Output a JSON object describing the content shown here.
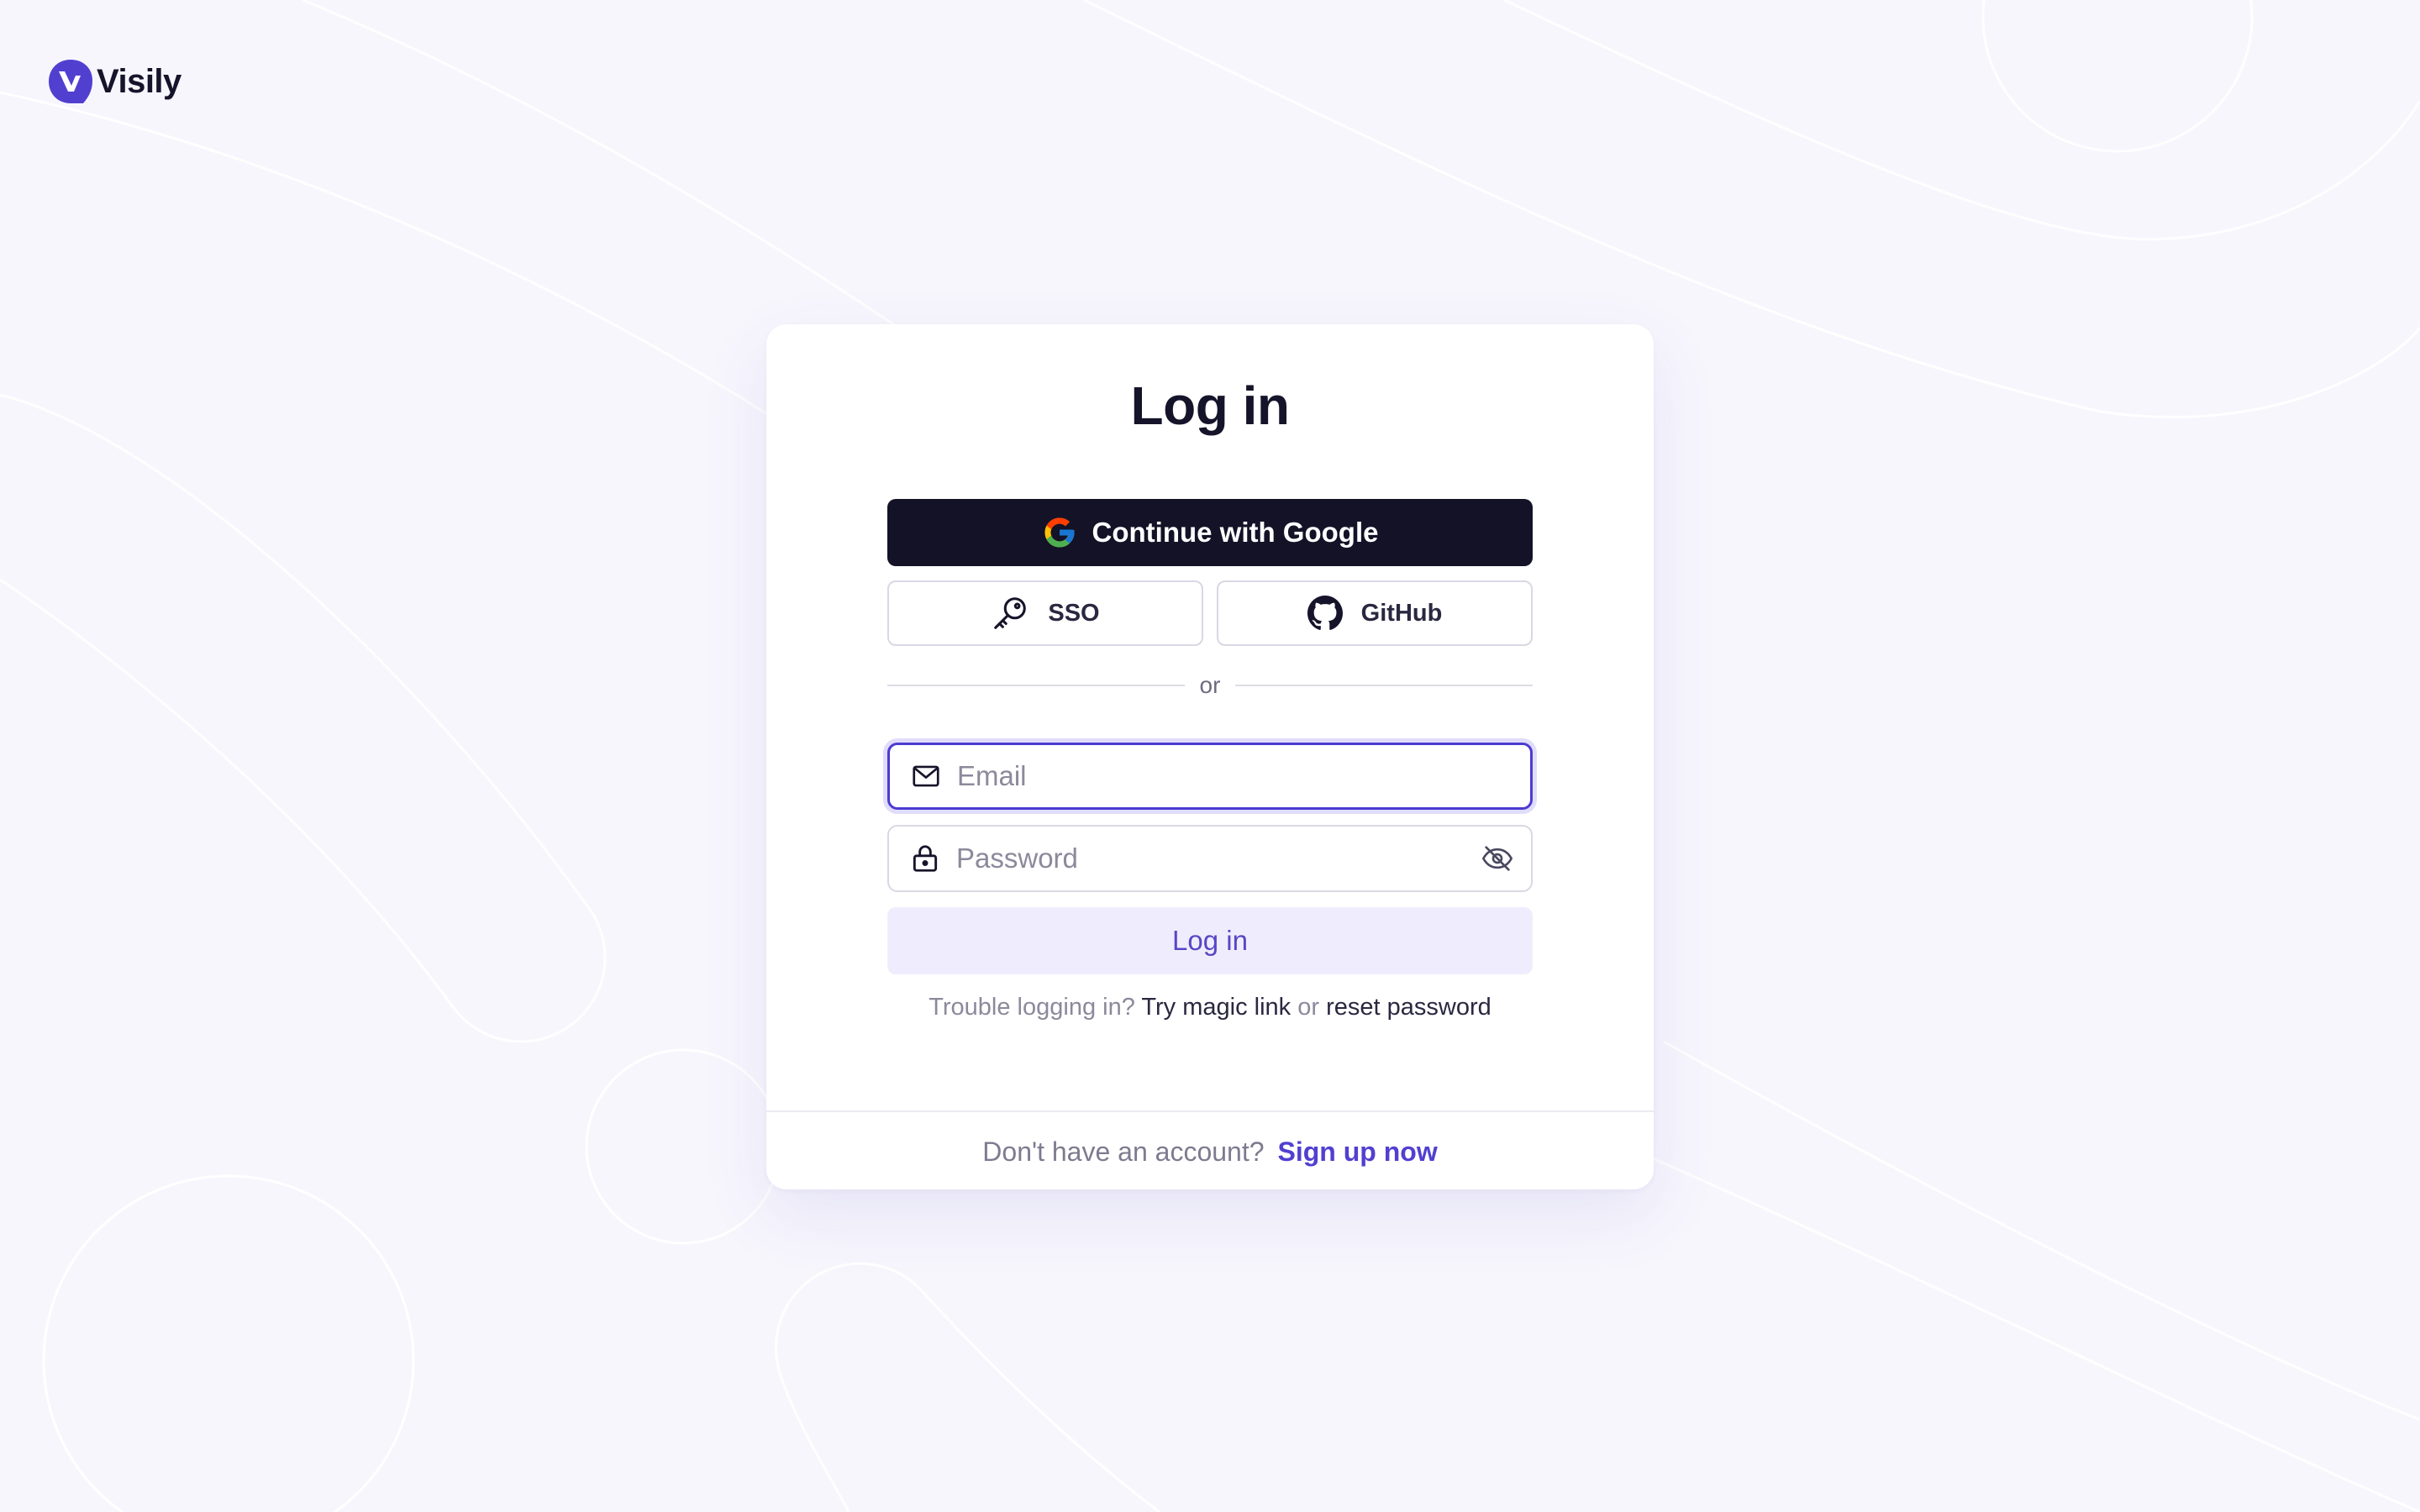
{
  "brand": {
    "name": "Visily",
    "accent_color": "#5140d0"
  },
  "login_card": {
    "title": "Log in",
    "google_button": {
      "label": "Continue with Google",
      "icon": "google-icon"
    },
    "sso_button": {
      "label": "SSO",
      "icon": "key-icon"
    },
    "github_button": {
      "label": "GitHub",
      "icon": "github-icon"
    },
    "divider_text": "or",
    "email_field": {
      "placeholder": "Email",
      "value": "",
      "icon": "mail-icon"
    },
    "password_field": {
      "placeholder": "Password",
      "value": "",
      "icon": "lock-icon",
      "toggle_icon": "eye-off-icon"
    },
    "submit_button": {
      "label": "Log in"
    },
    "help": {
      "prefix": "Trouble logging in?",
      "magic_link": "Try magic link",
      "or": "or",
      "reset_password": "reset password"
    },
    "footer": {
      "prompt": "Don't have an account?",
      "signup_link": "Sign up now"
    }
  }
}
